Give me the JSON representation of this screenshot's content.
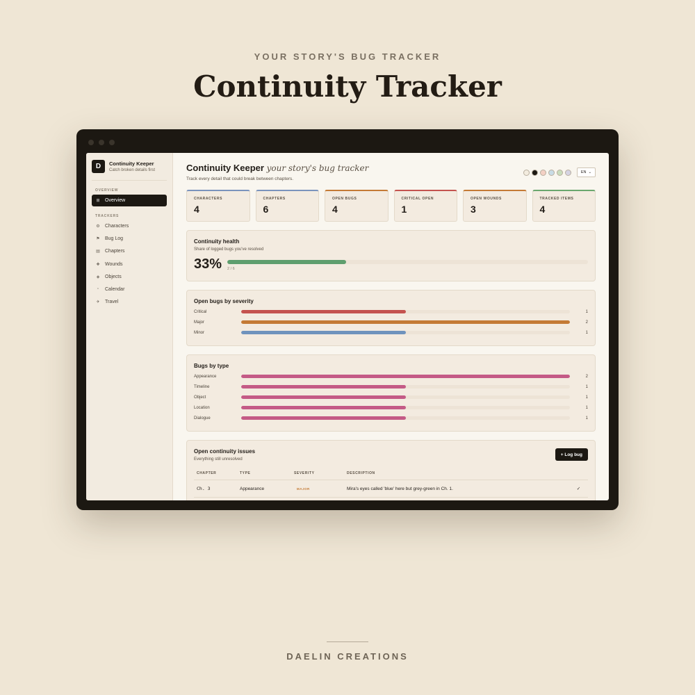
{
  "page": {
    "eyebrow": "YOUR STORY'S BUG TRACKER",
    "title": "Continuity Tracker",
    "footer": "DAELIN CREATIONS"
  },
  "sidebar": {
    "logo_letter": "D",
    "app_name": "Continuity Keeper",
    "app_tagline": "Catch broken details first",
    "section_overview": "OVERVIEW",
    "overview_label": "Overview",
    "section_trackers": "TRACKERS",
    "items": [
      {
        "label": "Characters",
        "icon": "⚙"
      },
      {
        "label": "Bug Log",
        "icon": "⚑"
      },
      {
        "label": "Chapters",
        "icon": "▤"
      },
      {
        "label": "Wounds",
        "icon": "✚"
      },
      {
        "label": "Objects",
        "icon": "◈"
      },
      {
        "label": "Calendar",
        "icon": "▫"
      },
      {
        "label": "Travel",
        "icon": "✈"
      }
    ]
  },
  "header": {
    "title": "Continuity Keeper",
    "title_italic": "your story's bug tracker",
    "subtitle": "Track every detail that could break between chapters.",
    "theme_swatches": [
      "#f3ecdf",
      "#1c1812",
      "#f3d0c4",
      "#c8dbe5",
      "#c9dcbc",
      "#d5d3e3"
    ],
    "language": "EN"
  },
  "stats": [
    {
      "label": "CHARACTERS",
      "value": "4",
      "color": "#7a93bd"
    },
    {
      "label": "CHAPTERS",
      "value": "6",
      "color": "#7a93bd"
    },
    {
      "label": "OPEN BUGS",
      "value": "4",
      "color": "#c47a35"
    },
    {
      "label": "CRITICAL OPEN",
      "value": "1",
      "color": "#c4534f"
    },
    {
      "label": "OPEN WOUNDS",
      "value": "3",
      "color": "#c47a35"
    },
    {
      "label": "TRACKED ITEMS",
      "value": "4",
      "color": "#6aa76e"
    }
  ],
  "health": {
    "title": "Continuity health",
    "subtitle": "Share of logged bugs you've resolved",
    "percent_label": "33%",
    "fraction_label": "2 / 6",
    "percent": 33,
    "color": "#5e9e6e"
  },
  "severity": {
    "title": "Open bugs by severity",
    "max": 2,
    "rows": [
      {
        "label": "Critical",
        "count": 1,
        "color": "#c4534f"
      },
      {
        "label": "Major",
        "count": 2,
        "color": "#c47a35"
      },
      {
        "label": "Minor",
        "count": 1,
        "color": "#6f93bd"
      }
    ]
  },
  "types": {
    "title": "Bugs by type",
    "max": 2,
    "color": "#c45a86",
    "rows": [
      {
        "label": "Appearance",
        "count": 2
      },
      {
        "label": "Timeline",
        "count": 1
      },
      {
        "label": "Object",
        "count": 1
      },
      {
        "label": "Location",
        "count": 1
      },
      {
        "label": "Dialogue",
        "count": 1
      }
    ]
  },
  "issues": {
    "title": "Open continuity issues",
    "subtitle": "Everything still unresolved",
    "button_label": "+ Log bug",
    "columns": [
      "CHAPTER",
      "TYPE",
      "SEVERITY",
      "DESCRIPTION"
    ],
    "rows": [
      {
        "chapter": "Ch. 3",
        "type": "Appearance",
        "severity": "MAJOR",
        "description": "Mira's eyes called 'blue' here but grey-green in Ch. 1.",
        "action": "✓"
      }
    ]
  }
}
